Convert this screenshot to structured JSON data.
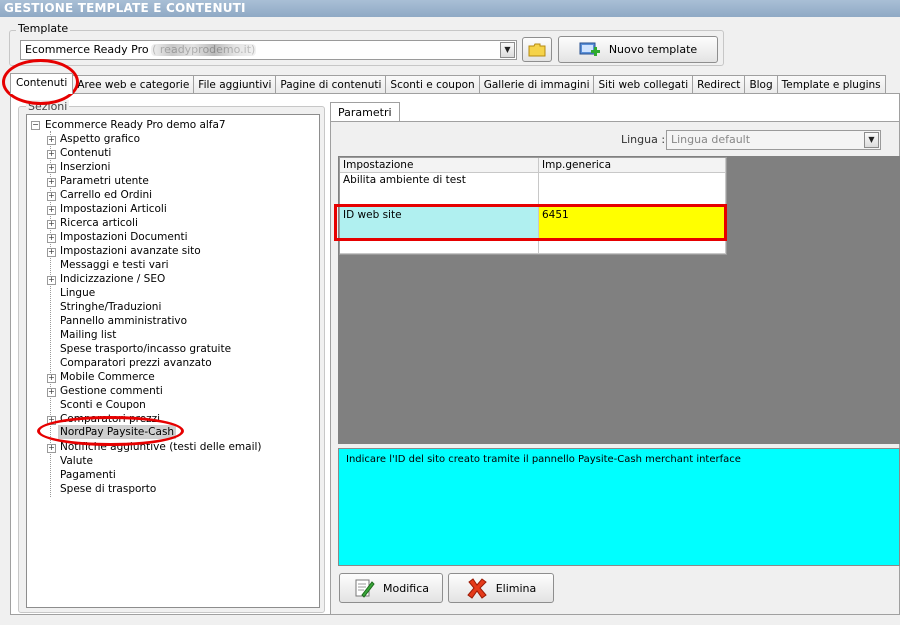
{
  "window": {
    "title": "GESTIONE TEMPLATE E CONTENUTI"
  },
  "template": {
    "label": "Template",
    "selected": "Ecommerce Ready Pro (                               readyprodemo.it)",
    "new_button": "Nuovo template"
  },
  "tabs": [
    {
      "label": "Contenuti"
    },
    {
      "label": "Aree web e categorie"
    },
    {
      "label": "File aggiuntivi"
    },
    {
      "label": "Pagine di contenuti"
    },
    {
      "label": "Sconti e coupon"
    },
    {
      "label": "Gallerie di immagini"
    },
    {
      "label": "Siti web collegati"
    },
    {
      "label": "Redirect"
    },
    {
      "label": "Blog"
    },
    {
      "label": "Template e plugins"
    }
  ],
  "tree": {
    "group_label": "Sezioni",
    "root": "Ecommerce Ready Pro demo alfa7",
    "items": [
      {
        "label": "Aspetto grafico"
      },
      {
        "label": "Contenuti"
      },
      {
        "label": "Inserzioni"
      },
      {
        "label": "Parametri utente"
      },
      {
        "label": "Carrello ed Ordini"
      },
      {
        "label": "Impostazioni Articoli"
      },
      {
        "label": "Ricerca articoli"
      },
      {
        "label": "Impostazioni Documenti"
      },
      {
        "label": "Impostazioni avanzate sito"
      },
      {
        "label": "Messaggi e testi vari"
      },
      {
        "label": "Indicizzazione / SEO"
      },
      {
        "label": "Lingue"
      },
      {
        "label": "Stringhe/Traduzioni"
      },
      {
        "label": "Pannello amministrativo"
      },
      {
        "label": "Mailing list"
      },
      {
        "label": "Spese trasporto/incasso gratuite"
      },
      {
        "label": "Comparatori prezzi avanzato"
      },
      {
        "label": "Mobile Commerce"
      },
      {
        "label": "Gestione commenti"
      },
      {
        "label": "Sconti e Coupon"
      },
      {
        "label": "Comparatori prezzi"
      },
      {
        "label": "NordPay Paysite-Cash"
      },
      {
        "label": "Notifiche aggiuntive (testi delle email)"
      },
      {
        "label": "Valute"
      },
      {
        "label": "Pagamenti"
      },
      {
        "label": "Spese di trasporto"
      }
    ]
  },
  "params": {
    "subtab": "Parametri",
    "language_label": "Lingua :",
    "language_value": "Lingua default",
    "columns": [
      "Impostazione",
      "Imp.generica"
    ],
    "rows": [
      {
        "setting": "Abilita ambiente di test",
        "value": ""
      },
      {
        "setting": "ID web site",
        "value": "6451"
      }
    ],
    "description": "Indicare l'ID del sito creato tramite il pannello Paysite-Cash merchant interface"
  },
  "buttons": {
    "modify": "Modifica",
    "delete": "Elimina"
  },
  "colors": {
    "highlight_red": "#e60000",
    "row_selected": "#b0f0f0",
    "value_cell": "#ffff00",
    "description_bg": "#00ffff",
    "grid_area": "#808080"
  }
}
